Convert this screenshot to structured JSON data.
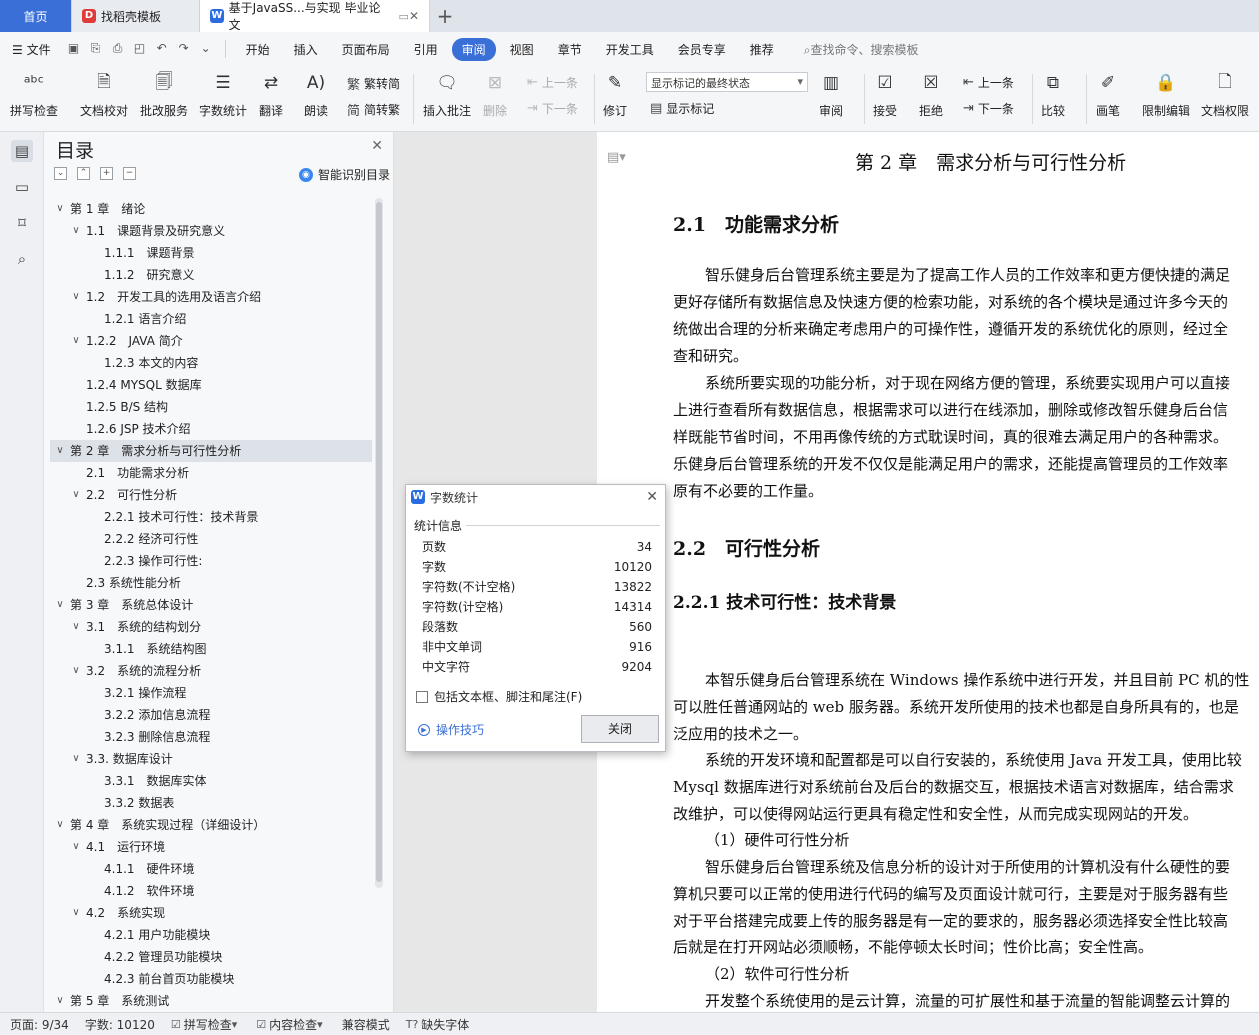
{
  "tabs": {
    "home": "首页",
    "template": "找稻壳模板",
    "document": "基于JavaSS...与实现 毕业论文"
  },
  "menu": {
    "file": "文件",
    "items": [
      "开始",
      "插入",
      "页面布局",
      "引用",
      "审阅",
      "视图",
      "章节",
      "开发工具",
      "会员专享",
      "推荐"
    ],
    "active": "审阅",
    "search": "查找命令、搜索模板"
  },
  "ribbon": {
    "spell": "拼写检查",
    "proof": "文档校对",
    "annotate_service": "批改服务",
    "word_count": "字数统计",
    "translate": "翻译",
    "read_aloud": "朗读",
    "trad": "繁转简",
    "simp": "简转繁",
    "insert_comment": "插入批注",
    "delete": "删除",
    "prev": "上一条",
    "next": "下一条",
    "revise": "修订",
    "show_markup_combo": "显示标记的最终状态",
    "show_markup": "显示标记",
    "review": "审阅",
    "accept": "接受",
    "reject": "拒绝",
    "prev2": "上一条",
    "next2": "下一条",
    "compare": "比较",
    "pen": "画笔",
    "restrict": "限制编辑",
    "doc_perm": "文档权限"
  },
  "toc": {
    "title": "目录",
    "smart": "智能识别目录",
    "items": [
      {
        "level": 0,
        "arrow": "∨",
        "text": "第 1 章　绪论"
      },
      {
        "level": 1,
        "arrow": "∨",
        "text": "1.1　课题背景及研究意义"
      },
      {
        "level": 2,
        "arrow": "",
        "text": "1.1.1　课题背景"
      },
      {
        "level": 2,
        "arrow": "",
        "text": "1.1.2　研究意义"
      },
      {
        "level": 1,
        "arrow": "∨",
        "text": "1.2　开发工具的选用及语言介绍"
      },
      {
        "level": 2,
        "arrow": "",
        "text": "1.2.1 语言介绍"
      },
      {
        "level": 1,
        "arrow": "∨",
        "text": "1.2.2　JAVA 简介"
      },
      {
        "level": 2,
        "arrow": "",
        "text": "1.2.3 本文的内容"
      },
      {
        "level": 1,
        "arrow": "",
        "text": "1.2.4 MYSQL 数据库"
      },
      {
        "level": 1,
        "arrow": "",
        "text": "1.2.5 B/S 结构"
      },
      {
        "level": 1,
        "arrow": "",
        "text": "1.2.6 JSP 技术介绍"
      },
      {
        "level": 0,
        "arrow": "∨",
        "text": "第 2 章　需求分析与可行性分析",
        "selected": true
      },
      {
        "level": 1,
        "arrow": "",
        "text": "2.1　功能需求分析"
      },
      {
        "level": 1,
        "arrow": "∨",
        "text": "2.2　可行性分析"
      },
      {
        "level": 2,
        "arrow": "",
        "text": "2.2.1 技术可行性：技术背景"
      },
      {
        "level": 2,
        "arrow": "",
        "text": "2.2.2 经济可行性"
      },
      {
        "level": 2,
        "arrow": "",
        "text": "2.2.3 操作可行性:"
      },
      {
        "level": 1,
        "arrow": "",
        "text": "2.3 系统性能分析"
      },
      {
        "level": 0,
        "arrow": "∨",
        "text": "第 3 章　系统总体设计"
      },
      {
        "level": 1,
        "arrow": "∨",
        "text": "3.1　系统的结构划分"
      },
      {
        "level": 2,
        "arrow": "",
        "text": "3.1.1　系统结构图"
      },
      {
        "level": 1,
        "arrow": "∨",
        "text": "3.2　系统的流程分析"
      },
      {
        "level": 2,
        "arrow": "",
        "text": "3.2.1 操作流程"
      },
      {
        "level": 2,
        "arrow": "",
        "text": "3.2.2 添加信息流程"
      },
      {
        "level": 2,
        "arrow": "",
        "text": "3.2.3 删除信息流程"
      },
      {
        "level": 1,
        "arrow": "∨",
        "text": "3.3. 数据库设计"
      },
      {
        "level": 2,
        "arrow": "",
        "text": "3.3.1　数据库实体"
      },
      {
        "level": 2,
        "arrow": "",
        "text": "3.3.2 数据表"
      },
      {
        "level": 0,
        "arrow": "∨",
        "text": "第 4 章　系统实现过程（详细设计）"
      },
      {
        "level": 1,
        "arrow": "∨",
        "text": "4.1　运行环境"
      },
      {
        "level": 2,
        "arrow": "",
        "text": "4.1.1　硬件环境"
      },
      {
        "level": 2,
        "arrow": "",
        "text": "4.1.2　软件环境"
      },
      {
        "level": 1,
        "arrow": "∨",
        "text": "4.2　系统实现"
      },
      {
        "level": 2,
        "arrow": "",
        "text": "4.2.1 用户功能模块"
      },
      {
        "level": 2,
        "arrow": "",
        "text": "4.2.2 管理员功能模块"
      },
      {
        "level": 2,
        "arrow": "",
        "text": "4.2.3 前台首页功能模块"
      },
      {
        "level": 0,
        "arrow": "∨",
        "text": "第 5 章　系统测试"
      }
    ]
  },
  "doc": {
    "chapter": "第 2 章　需求分析与可行性分析",
    "h21": "2.1　功能需求分析",
    "p1": [
      "智乐健身后台管理系统主要是为了提高工作人员的工作效率和更方便快捷的满足",
      "更好存储所有数据信息及快速方便的检索功能，对系统的各个模块是通过许多今天的",
      "统做出合理的分析来确定考虑用户的可操作性，遵循开发的系统优化的原则，经过全",
      "查和研究。"
    ],
    "p2": [
      "系统所要实现的功能分析，对于现在网络方便的管理，系统要实现用户可以直接",
      "上进行查看所有数据信息，根据需求可以进行在线添加，删除或修改智乐健身后台信",
      "样既能节省时间，不用再像传统的方式耽误时间，真的很难去满足用户的各种需求。",
      "乐健身后台管理系统的开发不仅仅是能满足用户的需求，还能提高管理员的工作效率",
      "原有不必要的工作量。"
    ],
    "h22": "2.2　可行性分析",
    "h221": "2.2.1 技术可行性：技术背景",
    "p3": [
      "本智乐健身后台管理系统在 Windows 操作系统中进行开发，并且目前 PC 机的性",
      "可以胜任普通网站的 web 服务器。系统开发所使用的技术也都是自身所具有的，也是",
      "泛应用的技术之一。"
    ],
    "p4": [
      "系统的开发环境和配置都是可以自行安装的，系统使用 Java 开发工具，使用比较",
      "Mysql 数据库进行对系统前台及后台的数据交互，根据技术语言对数据库，结合需求",
      "改维护，可以使得网站运行更具有稳定性和安全性，从而完成实现网站的开发。"
    ],
    "hw": "（1）硬件可行性分析",
    "p5": [
      "智乐健身后台管理系统及信息分析的设计对于所使用的计算机没有什么硬性的要",
      "算机只要可以正常的使用进行代码的编写及页面设计就可行，主要是对于服务器有些",
      "对于平台搭建完成要上传的服务器是有一定的要求的，服务器必须选择安全性比较高",
      "后就是在打开网站必须顺畅，不能停顿太长时间；性价比高；安全性高。"
    ],
    "sw": "（2）软件可行性分析",
    "p6": [
      "开发整个系统使用的是云计算，流量的可扩展性和基于流量的智能调整云计算的"
    ]
  },
  "dialog": {
    "title": "字数统计",
    "section": "统计信息",
    "rows": [
      {
        "label": "页数",
        "value": "34"
      },
      {
        "label": "字数",
        "value": "10120"
      },
      {
        "label": "字符数(不计空格)",
        "value": "13822"
      },
      {
        "label": "字符数(计空格)",
        "value": "14314"
      },
      {
        "label": "段落数",
        "value": "560"
      },
      {
        "label": "非中文单词",
        "value": "916"
      },
      {
        "label": "中文字符",
        "value": "9204"
      }
    ],
    "checkbox": "包括文本框、脚注和尾注(F)",
    "tips": "操作技巧",
    "close": "关闭"
  },
  "status": {
    "page": "页面: 9/34",
    "words": "字数: 10120",
    "spell": "拼写检查",
    "content": "内容检查",
    "compat": "兼容模式",
    "missing_font": "缺失字体"
  }
}
